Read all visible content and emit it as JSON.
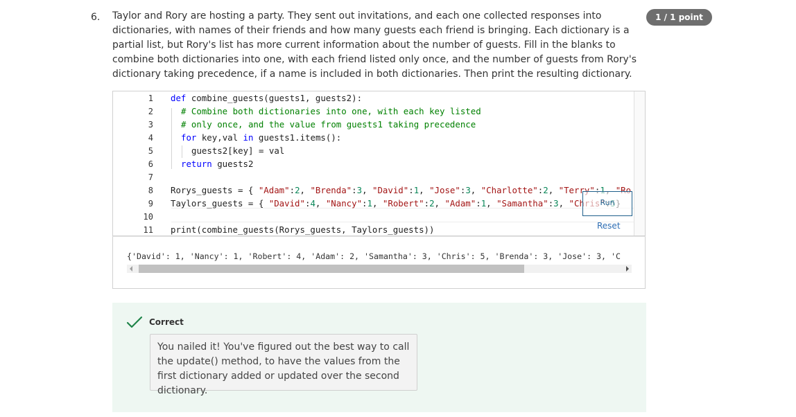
{
  "question": {
    "number": "6.",
    "text": "Taylor and Rory are hosting a party. They sent out invitations, and each one collected responses into dictionaries, with names of their friends and how many guests each friend is bringing. Each dictionary is a partial list, but Rory's list has more current information about the number of guests. Fill in the blanks to combine both dictionaries into one, with each friend listed only once, and the number of guests from Rory's dictionary taking precedence, if a name is included in both dictionaries. Then print the resulting dictionary.",
    "points_badge": "1 / 1 point"
  },
  "editor": {
    "line_numbers": [
      "1",
      "2",
      "3",
      "4",
      "5",
      "6",
      "7",
      "8",
      "9",
      "10",
      "11"
    ],
    "code": {
      "l1_kw": "def",
      "l1_rest": " combine_guests(guests1, guests2):",
      "l2": "# Combine both dictionaries into one, with each key listed",
      "l3": "# only once, and the value from guests1 taking precedence",
      "l4_kw1": "for",
      "l4_a": " key,val ",
      "l4_kw2": "in",
      "l4_b": " guests1.items():",
      "l5": "guests2[key] = val",
      "l6_kw": "return",
      "l6_rest": " guests2",
      "l8_a": "Rorys_guests = { ",
      "l8_s1": "\"Adam\"",
      "l8_n1": "2",
      "l8_s2": "\"Brenda\"",
      "l8_n2": "3",
      "l8_s3": "\"David\"",
      "l8_n3": "1",
      "l8_s4": "\"Jose\"",
      "l8_n4": "3",
      "l8_s5": "\"Charlotte\"",
      "l8_n5": "2",
      "l8_s6": "\"Terry\"",
      "l8_n6": "1",
      "l8_s7": "\"Ro",
      "l9_a": "Taylors_guests = { ",
      "l9_s1": "\"David\"",
      "l9_n1": "4",
      "l9_s2": "\"Nancy\"",
      "l9_n2": "1",
      "l9_s3": "\"Robert\"",
      "l9_n3": "2",
      "l9_s4": "\"Adam\"",
      "l9_n4": "1",
      "l9_s5": "\"Samantha\"",
      "l9_n5": "3",
      "l9_s6": "\"Chris\"",
      "l9_n6": "5",
      "l11": "print(combine_guests(Rorys_guests, Taylors_guests))"
    },
    "run_label": "Run",
    "reset_label": "Reset"
  },
  "output": {
    "text": "{'David': 1, 'Nancy': 1, 'Robert': 4, 'Adam': 2, 'Samantha': 3, 'Chris': 5, 'Brenda': 3, 'Jose': 3, 'C"
  },
  "feedback": {
    "status": "Correct",
    "message": "You nailed it! You've figured out the best way to call the update() method, to have the values from the first dictionary added or updated over the second dictionary."
  },
  "colors": {
    "keyword": "#0000ff",
    "comment": "#008000",
    "string": "#a31515",
    "number": "#098658",
    "success": "#1e8449",
    "feedback_bg": "#eef7f2"
  }
}
